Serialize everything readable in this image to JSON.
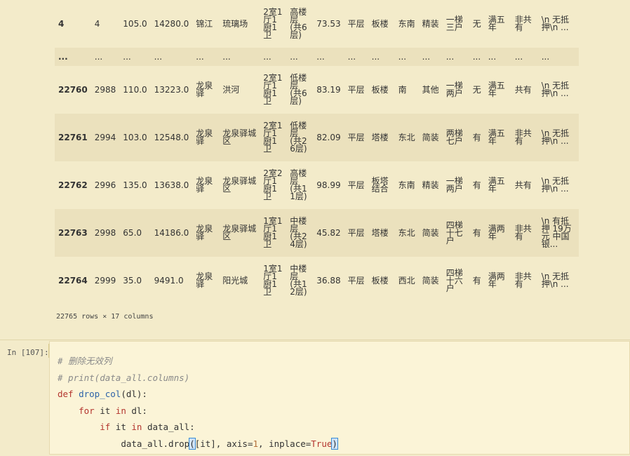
{
  "table": {
    "rows": [
      {
        "idx": "4",
        "cells": [
          "4",
          "105.0",
          "14280.0",
          "锦江",
          "琉璃场",
          "2室1厅1厨1卫",
          "高楼层 (共6层)",
          "73.53",
          "平层",
          "板楼",
          "东南",
          "精装",
          "一梯三户",
          "无",
          "满五年",
          "非共有",
          "\\n 无抵押\\n ..."
        ]
      },
      {
        "idx": "...",
        "cells": [
          "...",
          "...",
          "...",
          "...",
          "...",
          "...",
          "...",
          "...",
          "...",
          "...",
          "...",
          "...",
          "...",
          "...",
          "...",
          "...",
          "..."
        ]
      },
      {
        "idx": "22760",
        "cells": [
          "2988",
          "110.0",
          "13223.0",
          "龙泉驿",
          "洪河",
          "2室1厅1厨1卫",
          "低楼层 (共6层)",
          "83.19",
          "平层",
          "板楼",
          "南",
          "其他",
          "一梯两户",
          "无",
          "满五年",
          "共有",
          "\\n 无抵押\\n ..."
        ]
      },
      {
        "idx": "22761",
        "cells": [
          "2994",
          "103.0",
          "12548.0",
          "龙泉驿",
          "龙泉驿城区",
          "2室1厅1厨1卫",
          "低楼层 (共26层)",
          "82.09",
          "平层",
          "塔楼",
          "东北",
          "简装",
          "两梯七户",
          "有",
          "满五年",
          "非共有",
          "\\n 无抵押\\n ..."
        ]
      },
      {
        "idx": "22762",
        "cells": [
          "2996",
          "135.0",
          "13638.0",
          "龙泉驿",
          "龙泉驿城区",
          "2室2厅1厨1卫",
          "高楼层 (共11层)",
          "98.99",
          "平层",
          "板塔结合",
          "东南",
          "精装",
          "一梯两户",
          "有",
          "满五年",
          "共有",
          "\\n 无抵押\\n ..."
        ]
      },
      {
        "idx": "22763",
        "cells": [
          "2998",
          "65.0",
          "14186.0",
          "龙泉驿",
          "龙泉驿城区",
          "1室1厅1厨1卫",
          "中楼层 (共24层)",
          "45.82",
          "平层",
          "塔楼",
          "东北",
          "简装",
          "四梯十七户",
          "有",
          "满两年",
          "非共有",
          "\\n 有抵押 19万元 中国银..."
        ]
      },
      {
        "idx": "22764",
        "cells": [
          "2999",
          "35.0",
          "9491.0",
          "龙泉驿",
          "阳光城",
          "1室1厅1厨1卫",
          "中楼层 (共12层)",
          "36.88",
          "平层",
          "板楼",
          "西北",
          "简装",
          "四梯十六户",
          "有",
          "满两年",
          "非共有",
          "\\n 无抵押\\n ..."
        ]
      }
    ],
    "shape_text": "22765 rows × 17 columns"
  },
  "cell": {
    "prompt": "In [107]:",
    "code": {
      "c1": "# 删除无效列",
      "c2": "# print(data_all.columns)",
      "def_kw": "def",
      "fn_name": "drop_col",
      "def_rest": "(dl):",
      "for_kw": "for",
      "for_var": " it ",
      "in_kw": "in",
      "for_rest": " dl:",
      "if_kw": "if",
      "if_var": " it ",
      "in_kw2": "in",
      "if_rest": " data_all:",
      "call_pre": "data_all.drop",
      "paren_open": "(",
      "call_mid": "[it], axis=",
      "axis_val": "1",
      "call_mid2": ", inplace=",
      "true_val": "True",
      "paren_close": ")"
    }
  }
}
